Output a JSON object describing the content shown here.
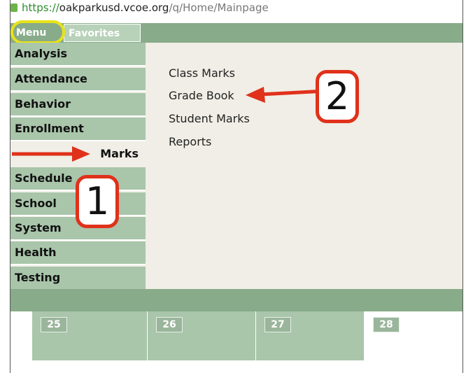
{
  "urlbar": {
    "scheme": "https://",
    "host": "oakparkusd.vcoe.org",
    "path": "/q/Home/Mainpage"
  },
  "tabs": {
    "menu": "Menu",
    "favorites": "Favorites"
  },
  "sidebar": {
    "items": [
      {
        "label": "Analysis"
      },
      {
        "label": "Attendance"
      },
      {
        "label": "Behavior"
      },
      {
        "label": "Enrollment"
      },
      {
        "label": "Marks"
      },
      {
        "label": "Schedule"
      },
      {
        "label": "School"
      },
      {
        "label": "System"
      },
      {
        "label": "Health"
      },
      {
        "label": "Testing"
      }
    ]
  },
  "submenu": {
    "items": [
      {
        "label": "Class Marks"
      },
      {
        "label": "Grade Book"
      },
      {
        "label": "Student Marks"
      },
      {
        "label": "Reports"
      }
    ]
  },
  "calendar": {
    "days": [
      "25",
      "26",
      "27",
      "28"
    ]
  },
  "annotations": {
    "step1": "1",
    "step2": "2",
    "arrow_color": "#e0311b",
    "highlight_color": "#e8e21a"
  }
}
